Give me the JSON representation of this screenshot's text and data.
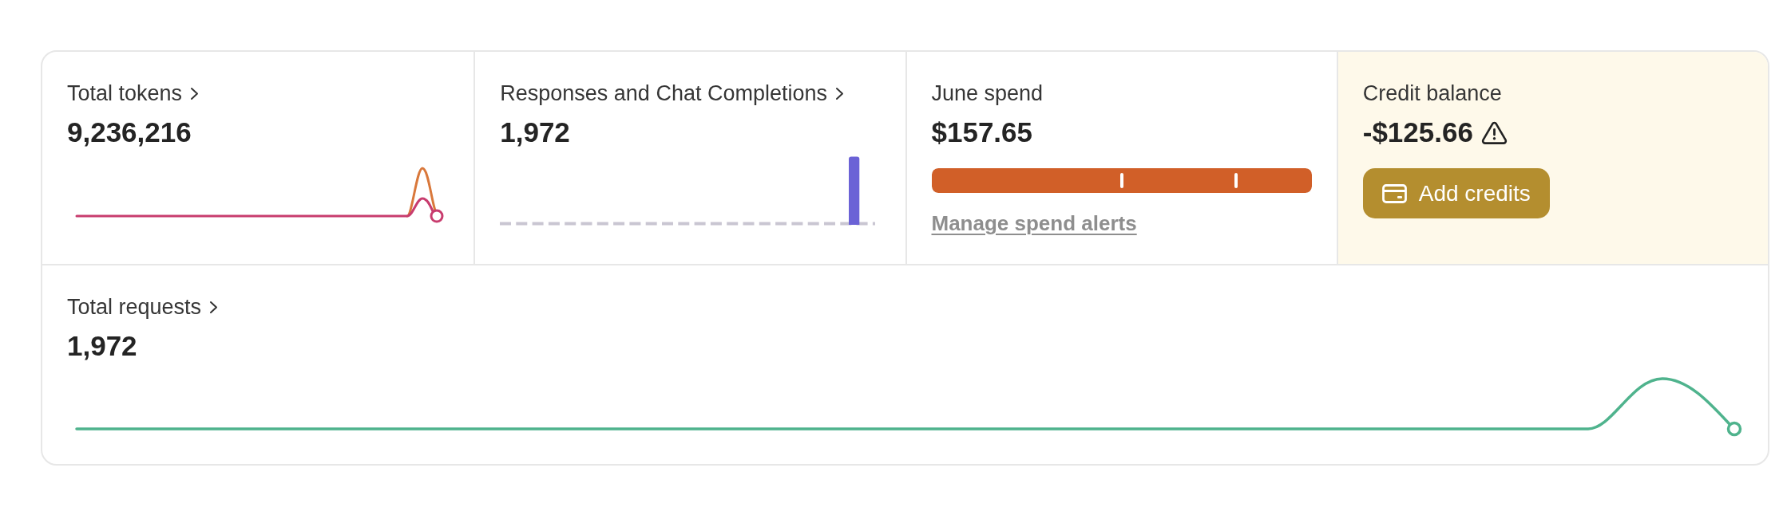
{
  "cards": [
    {
      "kind": "line",
      "label": "Total tokens",
      "chevron": true,
      "value": "9,236,216"
    },
    {
      "kind": "bars",
      "label": "Responses and Chat Completions",
      "chevron": true,
      "value": "1,972"
    },
    {
      "kind": "meter",
      "label": "June spend",
      "chevron": false,
      "value": "$157.65",
      "level": 1,
      "link": "Manage spend alerts"
    },
    {
      "kind": "action",
      "label": "Credit balance",
      "chevron": false,
      "value": "-$125.66",
      "warning": true,
      "button": "Add credits"
    }
  ],
  "total_requests": {
    "label": "Total requests",
    "chevron": true,
    "value": "1,972"
  }
}
